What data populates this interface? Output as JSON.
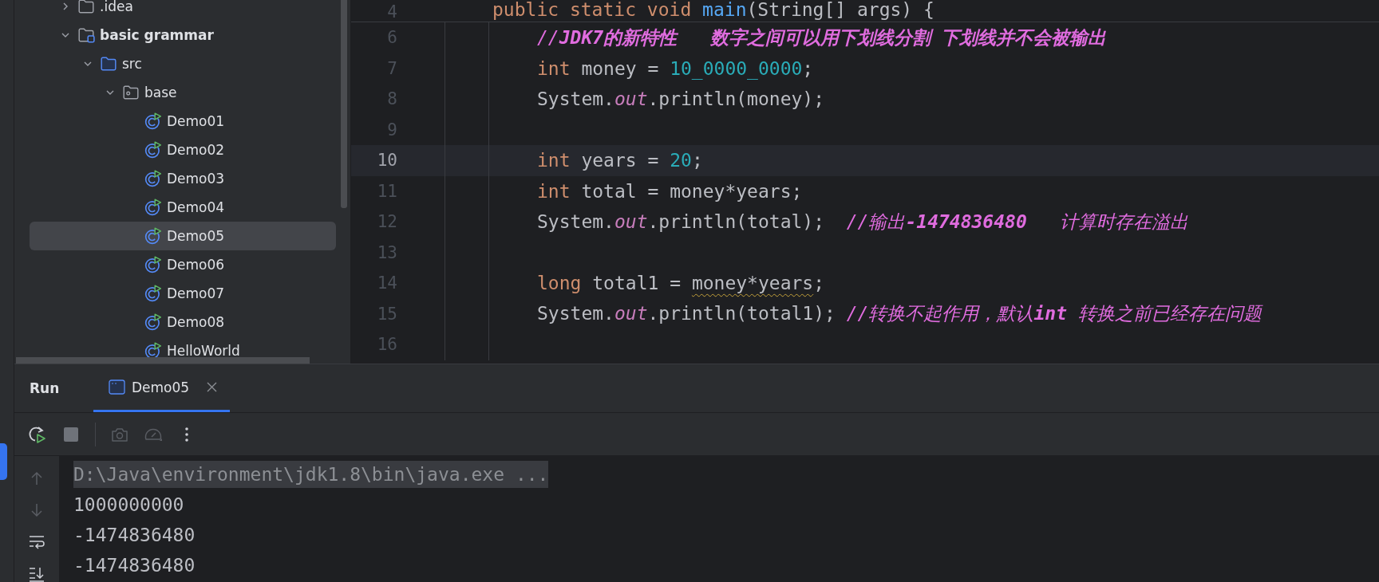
{
  "project_tree": [
    {
      "label": ".idea",
      "kind": "folder",
      "expanded": false,
      "selected": false
    },
    {
      "label": "basic grammar",
      "kind": "module",
      "expanded": true,
      "selected": false,
      "children": [
        {
          "label": "src",
          "kind": "source-folder",
          "expanded": true,
          "selected": false,
          "children": [
            {
              "label": "base",
              "kind": "package",
              "expanded": true,
              "selected": false,
              "children": [
                {
                  "label": "Demo01",
                  "kind": "class",
                  "selected": false
                },
                {
                  "label": "Demo02",
                  "kind": "class",
                  "selected": false
                },
                {
                  "label": "Demo03",
                  "kind": "class",
                  "selected": false
                },
                {
                  "label": "Demo04",
                  "kind": "class",
                  "selected": false
                },
                {
                  "label": "Demo05",
                  "kind": "class",
                  "selected": true
                },
                {
                  "label": "Demo06",
                  "kind": "class",
                  "selected": false
                },
                {
                  "label": "Demo07",
                  "kind": "class",
                  "selected": false
                },
                {
                  "label": "Demo08",
                  "kind": "class",
                  "selected": false
                },
                {
                  "label": "HelloWorld",
                  "kind": "class",
                  "selected": false
                }
              ]
            }
          ]
        }
      ]
    }
  ],
  "editor": {
    "sticky_line": {
      "number": "4",
      "tokens": [
        {
          "kind": "keyword",
          "text": "public static void "
        },
        {
          "kind": "method",
          "text": "main"
        },
        {
          "kind": "plain",
          "text": "(String[] args) {"
        }
      ]
    },
    "lines": [
      {
        "number": "6",
        "current": false,
        "tokens": [
          {
            "kind": "comment",
            "text": "//**JDK7的新特性   数字之间可以用下划线分割 下划线并不会被输出**"
          }
        ]
      },
      {
        "number": "7",
        "current": false,
        "tokens": [
          {
            "kind": "keyword",
            "text": "int "
          },
          {
            "kind": "plain",
            "text": "money = "
          },
          {
            "kind": "number",
            "text": "10_0000_0000"
          },
          {
            "kind": "plain",
            "text": ";"
          }
        ]
      },
      {
        "number": "8",
        "current": false,
        "tokens": [
          {
            "kind": "plain",
            "text": "System."
          },
          {
            "kind": "field",
            "text": "out"
          },
          {
            "kind": "plain",
            "text": ".println(money);"
          }
        ]
      },
      {
        "number": "9",
        "current": false
      },
      {
        "number": "10",
        "current": true,
        "tokens": [
          {
            "kind": "keyword",
            "text": "int "
          },
          {
            "kind": "plain",
            "text": "years = "
          },
          {
            "kind": "number",
            "text": "20"
          },
          {
            "kind": "plain",
            "text": ";"
          }
        ]
      },
      {
        "number": "11",
        "current": false,
        "tokens": [
          {
            "kind": "keyword",
            "text": "int "
          },
          {
            "kind": "plain",
            "text": "total = money*years;"
          }
        ]
      },
      {
        "number": "12",
        "current": false,
        "tokens": [
          {
            "kind": "plain",
            "text": "System."
          },
          {
            "kind": "field",
            "text": "out"
          },
          {
            "kind": "plain",
            "text": ".println(total);  "
          },
          {
            "kind": "comment",
            "text": "//输出**-1474836480**   计算时存在溢出"
          }
        ]
      },
      {
        "number": "13",
        "current": false
      },
      {
        "number": "14",
        "current": false,
        "tokens": [
          {
            "kind": "keyword",
            "text": "long "
          },
          {
            "kind": "plain",
            "text": "total1 = "
          },
          {
            "kind": "warned",
            "text": "money*years"
          },
          {
            "kind": "plain",
            "text": ";"
          }
        ]
      },
      {
        "number": "15",
        "current": false,
        "tokens": [
          {
            "kind": "plain",
            "text": "System."
          },
          {
            "kind": "field",
            "text": "out"
          },
          {
            "kind": "plain",
            "text": ".println(total1); "
          },
          {
            "kind": "comment",
            "text": "//转换不起作用，默认**int** 转换之前已经存在问题"
          }
        ]
      },
      {
        "number": "16",
        "current": false
      }
    ]
  },
  "run_panel": {
    "title": "Run",
    "tabs": [
      {
        "label": "Demo05",
        "selected": true
      }
    ],
    "toolbar": [
      {
        "kind": "rerun",
        "disabled": false
      },
      {
        "kind": "stop",
        "disabled": false
      },
      {
        "kind": "separator"
      },
      {
        "kind": "camera",
        "disabled": true
      },
      {
        "kind": "gauge",
        "disabled": true
      },
      {
        "kind": "more",
        "disabled": false
      }
    ],
    "gutter": [
      {
        "kind": "up",
        "disabled": true
      },
      {
        "kind": "down",
        "disabled": true
      },
      {
        "kind": "wrap",
        "disabled": false
      },
      {
        "kind": "scroll-end",
        "disabled": false
      }
    ],
    "console": [
      {
        "kind": "command",
        "text": "D:\\Java\\environment\\jdk1.8\\bin\\java.exe ..."
      },
      {
        "kind": "output",
        "text": "1000000000"
      },
      {
        "kind": "output",
        "text": "-1474836480"
      },
      {
        "kind": "output",
        "text": "-1474836480"
      }
    ]
  }
}
